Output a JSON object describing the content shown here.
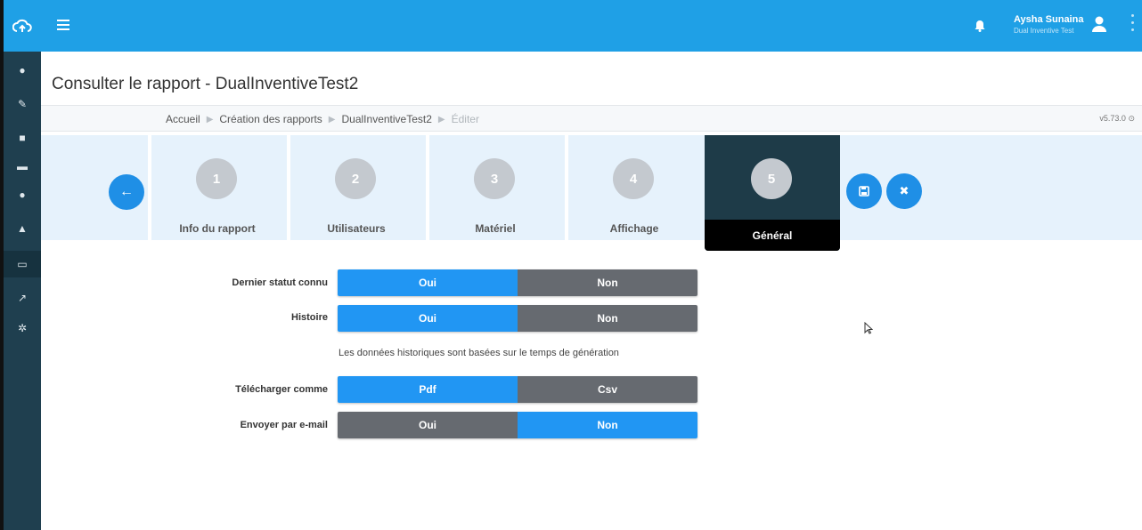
{
  "header": {
    "user_name": "Aysha Sunaina",
    "user_org": "Dual Inventive Test"
  },
  "sidebar": {
    "items": [
      {
        "icon": "user-icon",
        "glyph": "●"
      },
      {
        "icon": "wrench-icon",
        "glyph": "✎"
      },
      {
        "icon": "vehicle-icon",
        "glyph": "■"
      },
      {
        "icon": "folder-icon",
        "glyph": "▬"
      },
      {
        "icon": "globe-icon",
        "glyph": "●"
      },
      {
        "icon": "graduation-icon",
        "glyph": "▲"
      },
      {
        "icon": "inbox-icon",
        "glyph": "▭"
      },
      {
        "icon": "chart-icon",
        "glyph": "↗"
      },
      {
        "icon": "gear-icon",
        "glyph": "✲"
      }
    ]
  },
  "page": {
    "title": "Consulter le rapport - DualInventiveTest2",
    "version": "v5.73.0"
  },
  "breadcrumb": {
    "items": [
      "Accueil",
      "Création des rapports",
      "DualInventiveTest2",
      "Éditer"
    ]
  },
  "steps": [
    {
      "number": "1",
      "label": "Info du rapport"
    },
    {
      "number": "2",
      "label": "Utilisateurs"
    },
    {
      "number": "3",
      "label": "Matériel"
    },
    {
      "number": "4",
      "label": "Affichage"
    },
    {
      "number": "5",
      "label": "Général"
    }
  ],
  "form": {
    "last_status": {
      "label": "Dernier statut connu",
      "options": [
        "Oui",
        "Non"
      ],
      "selected": "Oui"
    },
    "history": {
      "label": "Histoire",
      "options": [
        "Oui",
        "Non"
      ],
      "selected": "Oui"
    },
    "history_hint": "Les données historiques sont basées sur le temps de génération",
    "download_as": {
      "label": "Télécharger comme",
      "options": [
        "Pdf",
        "Csv"
      ],
      "selected": "Pdf"
    },
    "send_email": {
      "label": "Envoyer par e-mail",
      "options": [
        "Oui",
        "Non"
      ],
      "selected": "Non"
    }
  },
  "colors": {
    "topbar": "#1fa0e6",
    "sidebar": "#1f3f4f",
    "selected_option": "#2196f3",
    "unselected_option": "#666a70",
    "active_step": "#1e3b48"
  }
}
